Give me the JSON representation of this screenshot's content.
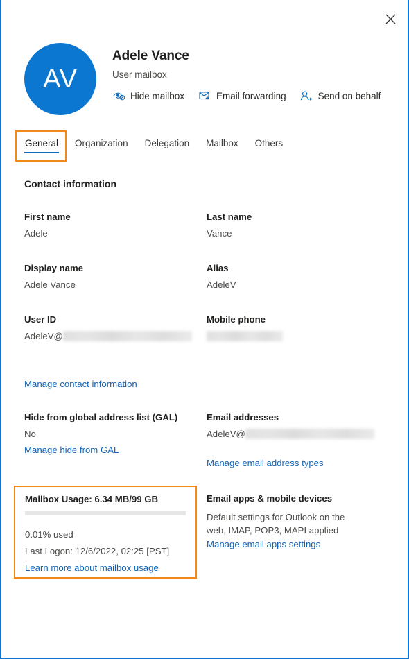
{
  "window": {
    "close_label": "Close",
    "border_color": "#0f76d3",
    "highlight_color": "#f0881a",
    "accent_color": "#0f6cbd"
  },
  "header": {
    "avatar_initials": "AV",
    "avatar_color": "#0c77d0",
    "name": "Adele Vance",
    "subtitle": "User mailbox",
    "actions": [
      {
        "label": "Hide mailbox",
        "icon": "eye-slash-icon"
      },
      {
        "label": "Email forwarding",
        "icon": "envelope-forward-icon"
      },
      {
        "label": "Send on behalf",
        "icon": "person-arrow-icon"
      }
    ]
  },
  "tabs": [
    {
      "label": "General",
      "selected": true
    },
    {
      "label": "Organization",
      "selected": false
    },
    {
      "label": "Delegation",
      "selected": false
    },
    {
      "label": "Mailbox",
      "selected": false
    },
    {
      "label": "Others",
      "selected": false
    }
  ],
  "contact": {
    "section_title": "Contact information",
    "first_name_label": "First name",
    "first_name_value": "Adele",
    "last_name_label": "Last name",
    "last_name_value": "Vance",
    "display_name_label": "Display name",
    "display_name_value": "Adele Vance",
    "alias_label": "Alias",
    "alias_value": "AdeleV",
    "user_id_label": "User ID",
    "user_id_value": "AdeleV@",
    "user_id_redacted": true,
    "mobile_phone_label": "Mobile phone",
    "mobile_phone_value": "",
    "mobile_phone_redacted": true,
    "manage_contact_link": "Manage contact information"
  },
  "gal": {
    "label": "Hide from global address list (GAL)",
    "value": "No",
    "manage_link": "Manage hide from GAL"
  },
  "email_addresses": {
    "label": "Email addresses",
    "value": "AdeleV@",
    "redacted": true,
    "manage_link": "Manage email address types"
  },
  "mailbox_usage": {
    "title": "Mailbox Usage: 6.34 MB/99 GB",
    "used_text": "0.01% used",
    "percent": 0.01,
    "last_logon": "Last Logon: 12/6/2022, 02:25 [PST]",
    "learn_more_link": "Learn more about mailbox usage"
  },
  "email_apps": {
    "label": "Email apps & mobile devices",
    "description": "Default settings for Outlook on the web, IMAP, POP3, MAPI applied",
    "manage_link": "Manage email apps settings"
  }
}
